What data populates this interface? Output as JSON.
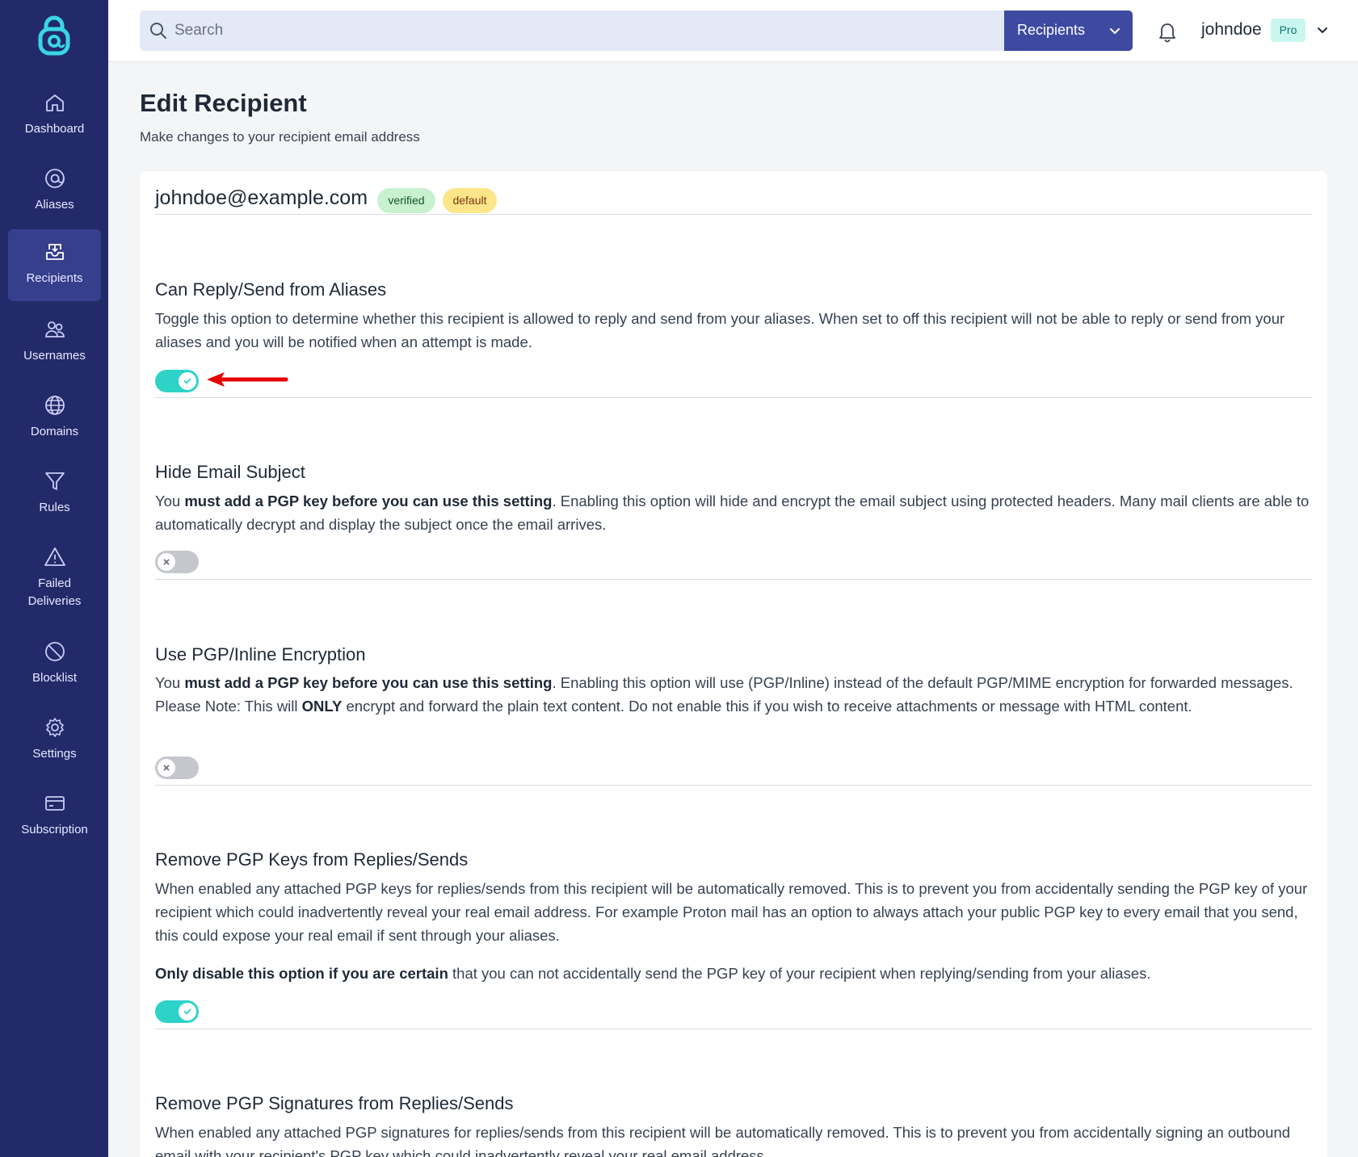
{
  "sidebar": {
    "items": [
      {
        "label": "Dashboard",
        "icon": "home-icon",
        "active": false
      },
      {
        "label": "Aliases",
        "icon": "at-sign-icon",
        "active": false
      },
      {
        "label": "Recipients",
        "icon": "inbox-icon",
        "active": true
      },
      {
        "label": "Usernames",
        "icon": "users-icon",
        "active": false
      },
      {
        "label": "Domains",
        "icon": "globe-icon",
        "active": false
      },
      {
        "label": "Rules",
        "icon": "filter-icon",
        "active": false
      },
      {
        "label": "Failed\nDeliveries",
        "icon": "warning-icon",
        "active": false
      },
      {
        "label": "Blocklist",
        "icon": "block-icon",
        "active": false
      },
      {
        "label": "Settings",
        "icon": "gear-icon",
        "active": false
      },
      {
        "label": "Subscription",
        "icon": "credit-card-icon",
        "active": false
      }
    ]
  },
  "topbar": {
    "search_placeholder": "Search",
    "search_scope": "Recipients",
    "username": "johndoe",
    "plan_badge": "Pro"
  },
  "page": {
    "title": "Edit Recipient",
    "subtitle": "Make changes to your recipient email address"
  },
  "recipient": {
    "email": "johndoe@example.com",
    "badges": [
      "verified",
      "default"
    ]
  },
  "settings": [
    {
      "title": "Can Reply/Send from Aliases",
      "description": "Toggle this option to determine whether this recipient is allowed to reply and send from your aliases. When set to off this recipient will not be able to reply or send from your aliases and you will be notified when an attempt is made.",
      "enabled": true
    },
    {
      "title": "Hide Email Subject",
      "description_prefix": "You ",
      "description_bold": "must add a PGP key before you can use this setting",
      "description_rest": ". Enabling this option will hide and encrypt the email subject using protected headers. Many mail clients are able to automatically decrypt and display the subject once the email arrives.",
      "enabled": false
    },
    {
      "title": "Use PGP/Inline Encryption",
      "description_prefix": "You ",
      "description_bold": "must add a PGP key before you can use this setting",
      "description_mid": ". Enabling this option will use (PGP/Inline) instead of the default PGP/MIME encryption for forwarded messages. Please Note: This will ",
      "description_bold2": "ONLY",
      "description_rest": " encrypt and forward the plain text content. Do not enable this if you wish to receive attachments or message with HTML content.",
      "enabled": false
    },
    {
      "title": "Remove PGP Keys from Replies/Sends",
      "description": "When enabled any attached PGP keys for replies/sends from this recipient will be automatically removed. This is to prevent you from accidentally sending the PGP key of your recipient which could inadvertently reveal your real email address. For example Proton mail has an option to always attach your public PGP key to every email that you send, this could expose your real email if sent through your aliases.",
      "note_bold": "Only disable this option if you are certain",
      "note_rest": " that you can not accidentally send the PGP key of your recipient when replying/sending from your aliases.",
      "enabled": true
    },
    {
      "title": "Remove PGP Signatures from Replies/Sends",
      "description": "When enabled any attached PGP signatures for replies/sends from this recipient will be automatically removed. This is to prevent you from accidentally signing an outbound email with your recipient's PGP key which could inadvertently reveal your real email address."
    }
  ],
  "colors": {
    "sidebar_bg": "#232a6a",
    "accent": "#3d4aa0",
    "toggle_on": "#2ed3c8",
    "annotation_arrow": "#e60000"
  }
}
